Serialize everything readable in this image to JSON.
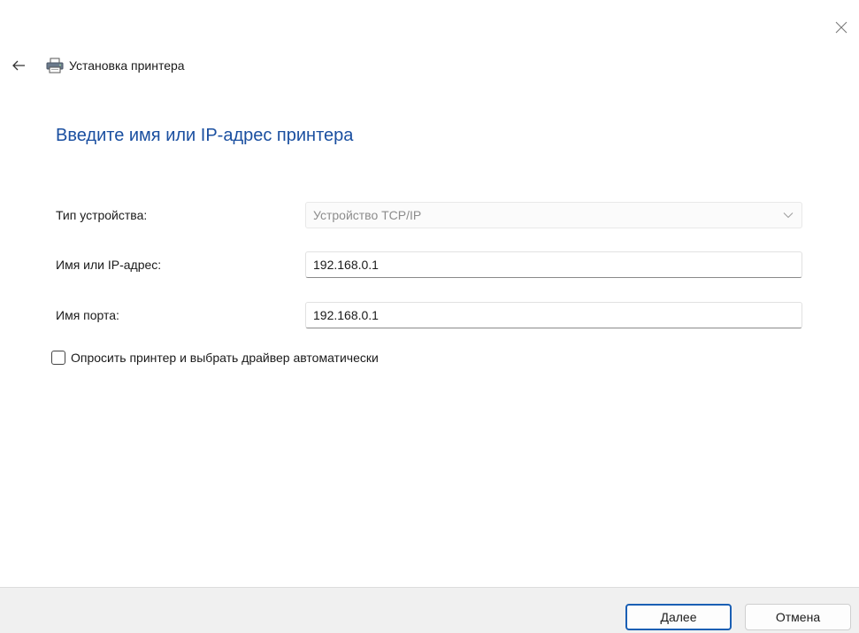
{
  "window": {
    "title": "Установка принтера"
  },
  "icons": {
    "close": "close-icon",
    "back": "back-arrow-icon",
    "printer": "printer-icon",
    "chevron": "chevron-down-icon"
  },
  "main": {
    "heading": "Введите имя или IP-адрес принтера",
    "device_type": {
      "label": "Тип устройства:",
      "value": "Устройство TCP/IP"
    },
    "hostname": {
      "label": "Имя или IP-адрес:",
      "value": "192.168.0.1"
    },
    "port_name": {
      "label": "Имя порта:",
      "value": "192.168.0.1"
    },
    "auto_driver": {
      "label": "Опросить принтер и выбрать драйвер автоматически",
      "checked": false
    }
  },
  "footer": {
    "next_label": "Далее",
    "cancel_label": "Отмена"
  },
  "colors": {
    "heading": "#1a4fa0",
    "default_button_border": "#1a5fb4",
    "footer_background": "#f0f0f0"
  }
}
